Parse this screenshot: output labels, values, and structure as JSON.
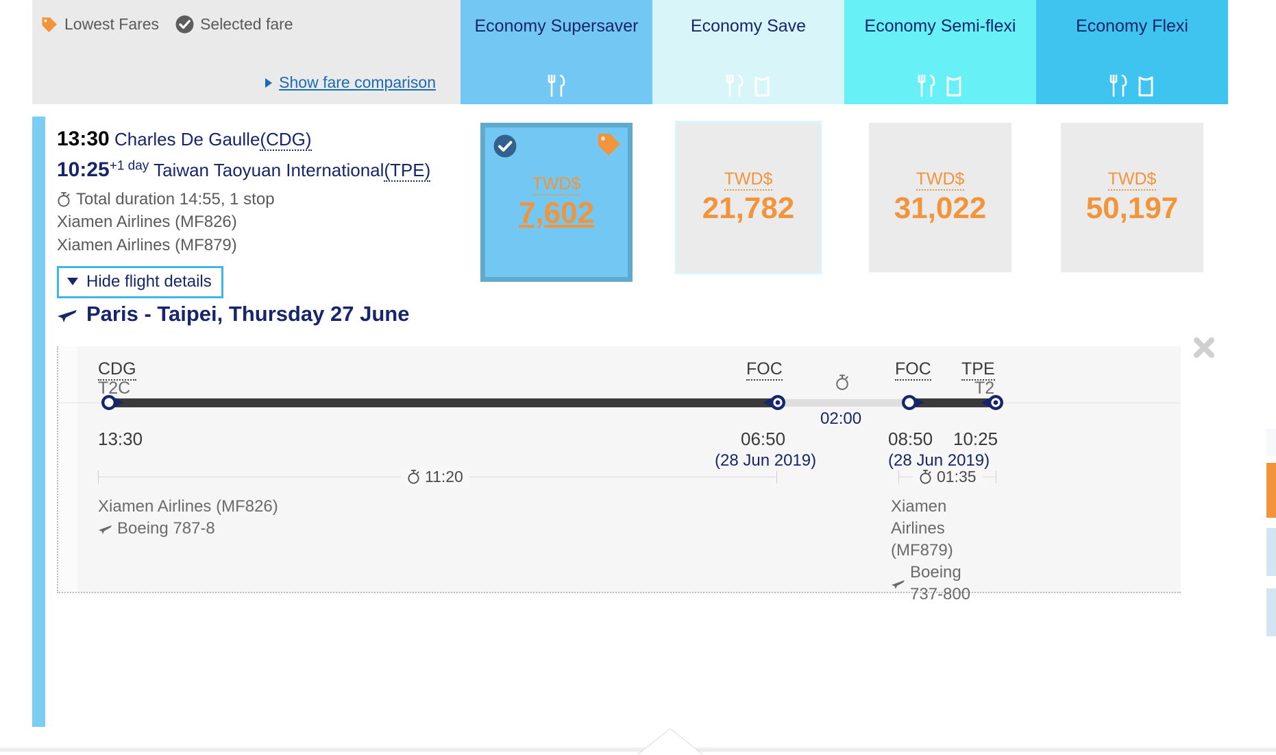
{
  "legend": {
    "lowest_fares": "Lowest Fares",
    "selected_fare": "Selected fare",
    "show_comparison": "Show fare comparison"
  },
  "fare_columns": [
    {
      "title": "Economy Supersaver",
      "bg": "#72c8f2",
      "meal": true,
      "seat": false
    },
    {
      "title": "Economy Save",
      "bg": "#d8f6f9",
      "meal": true,
      "seat": true
    },
    {
      "title": "Economy Semi-flexi",
      "bg": "#67f0f5",
      "meal": true,
      "seat": true
    },
    {
      "title": "Economy Flexi",
      "bg": "#3fc4f0",
      "meal": true,
      "seat": true
    }
  ],
  "flight": {
    "depart_time": "13:30",
    "depart_airport": "Charles De Gaulle",
    "depart_code": "(CDG)",
    "arrive_time": "10:25",
    "arrive_plus_day": "+1 day",
    "arrive_airport": "Taiwan Taoyuan International",
    "arrive_code": "(TPE)",
    "duration": "Total duration 14:55, 1 stop",
    "carrier_1": "Xiamen Airlines (MF826)",
    "carrier_2": "Xiamen Airlines (MF879)",
    "hide_details": "Hide flight details"
  },
  "prices": [
    {
      "currency": "TWD$",
      "value": "7,602",
      "selected": true,
      "lowest": true
    },
    {
      "currency": "TWD$",
      "value": "21,782",
      "selected": false,
      "lowest": false
    },
    {
      "currency": "TWD$",
      "value": "31,022",
      "selected": false,
      "lowest": false
    },
    {
      "currency": "TWD$",
      "value": "50,197",
      "selected": false,
      "lowest": false
    }
  ],
  "details": {
    "title": "Paris - Taipei, Thursday 27 June",
    "nodes": [
      {
        "code": "CDG",
        "terminal": "T2C",
        "time": "13:30",
        "date": ""
      },
      {
        "code": "FOC",
        "terminal": "",
        "time": "06:50",
        "date": "(28 Jun 2019)"
      },
      {
        "code": "FOC",
        "terminal": "",
        "time": "08:50",
        "date": "(28 Jun 2019)"
      },
      {
        "code": "TPE",
        "terminal": "T2",
        "time": "10:25",
        "date": ""
      }
    ],
    "layover": "02:00",
    "segments": [
      {
        "duration": "11:20",
        "airline": "Xiamen Airlines (MF826)",
        "aircraft": "Boeing 787-8"
      },
      {
        "duration": "01:35",
        "airline": "Xiamen Airlines (MF879)",
        "aircraft": "Boeing 737-800"
      }
    ]
  },
  "colors": {
    "accent_blue": "#7ccdf4",
    "navy": "#17256b",
    "orange": "#f2943b",
    "link_blue": "#1a6bb5"
  }
}
